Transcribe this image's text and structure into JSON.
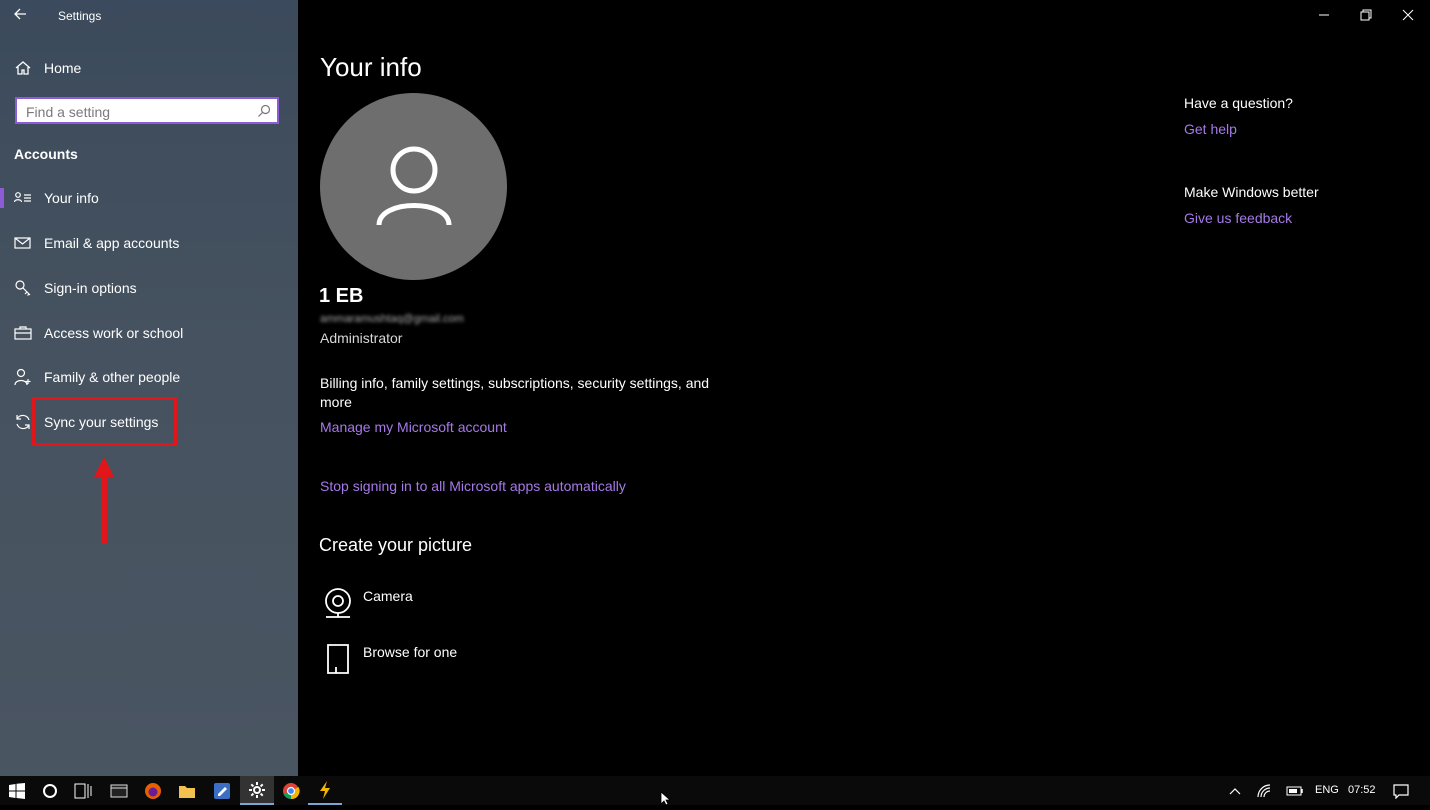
{
  "app": {
    "title": "Settings"
  },
  "sidebar": {
    "home_label": "Home",
    "search_placeholder": "Find a setting",
    "section_title": "Accounts",
    "items": [
      {
        "label": "Your info",
        "icon": "contact-icon",
        "selected": true
      },
      {
        "label": "Email & app accounts",
        "icon": "mail-icon"
      },
      {
        "label": "Sign-in options",
        "icon": "key-icon"
      },
      {
        "label": "Access work or school",
        "icon": "briefcase-icon"
      },
      {
        "label": "Family & other people",
        "icon": "person-add-icon"
      },
      {
        "label": "Sync your settings",
        "icon": "sync-icon"
      }
    ]
  },
  "main": {
    "title": "Your info",
    "user": {
      "name": "1 EB",
      "email": "ammaramushtaq@gmail.com",
      "role": "Administrator"
    },
    "billing_text": "Billing info, family settings, subscriptions, security settings, and more",
    "manage_link": "Manage my Microsoft account",
    "stop_link": "Stop signing in to all Microsoft apps automatically",
    "create_title": "Create your picture",
    "picture_options": [
      {
        "label": "Camera",
        "icon": "camera-icon"
      },
      {
        "label": "Browse for one",
        "icon": "document-icon"
      }
    ]
  },
  "right": {
    "question_heading": "Have a question?",
    "get_help": "Get help",
    "better_heading": "Make Windows better",
    "feedback": "Give us feedback"
  },
  "taskbar": {
    "language": "ENG",
    "time": "07:52"
  },
  "colors": {
    "accent": "#a679e8",
    "highlight": "#e0161b",
    "sidebar_top": "#3b4a5c"
  }
}
